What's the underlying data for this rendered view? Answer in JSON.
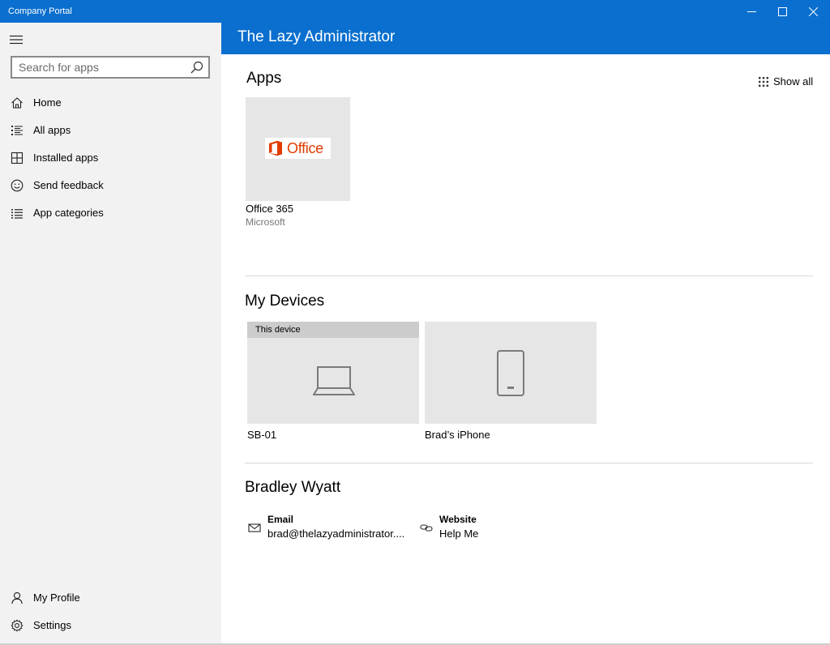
{
  "window": {
    "title": "Company Portal",
    "controls": {
      "minimize": "minimize-icon",
      "maximize": "maximize-icon",
      "close": "close-icon"
    },
    "accent_color": "#0a6fcf"
  },
  "sidebar": {
    "search": {
      "placeholder": "Search for apps",
      "value": ""
    },
    "items": [
      {
        "label": "Home",
        "icon": "home-icon"
      },
      {
        "label": "All apps",
        "icon": "list-icon"
      },
      {
        "label": "Installed apps",
        "icon": "installed-apps-icon"
      },
      {
        "label": "Send feedback",
        "icon": "smiley-icon"
      },
      {
        "label": "App categories",
        "icon": "categories-icon"
      }
    ],
    "bottom_items": [
      {
        "label": "My Profile",
        "icon": "person-icon"
      },
      {
        "label": "Settings",
        "icon": "gear-icon"
      }
    ]
  },
  "header": {
    "title": "The Lazy Administrator"
  },
  "apps": {
    "title": "Apps",
    "show_all": "Show all",
    "items": [
      {
        "logo_text": "Office",
        "name": "Office 365",
        "publisher": "Microsoft"
      }
    ]
  },
  "devices": {
    "title": "My Devices",
    "items": [
      {
        "banner": "This device",
        "name": "SB-01",
        "icon": "laptop-icon"
      },
      {
        "banner": "",
        "name": "Brad’s iPhone",
        "icon": "phone-icon"
      }
    ]
  },
  "profile": {
    "title": "Bradley Wyatt",
    "email_label": "Email",
    "email_value": "brad@thelazyadministrator....",
    "website_label": "Website",
    "website_value": "Help Me"
  }
}
